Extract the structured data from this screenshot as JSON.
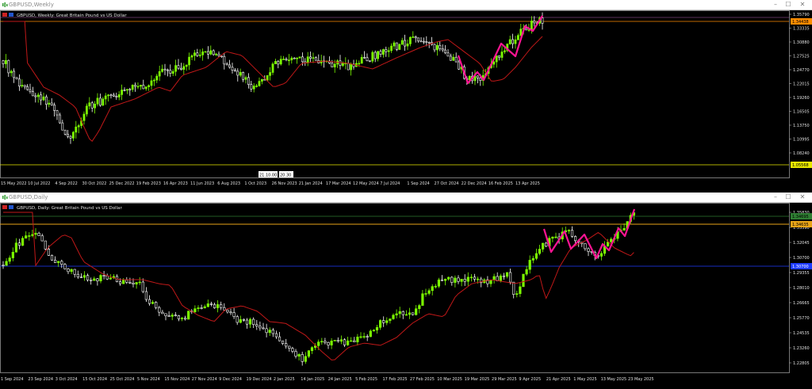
{
  "top_window": {
    "title": "GBPUSD,Weekly",
    "chart_label": "GBPUSD, Weekly:  Great Britain Pound vs US Dollar",
    "price_ticks": [
      "1.35790",
      "1.33335",
      "1.30880",
      "1.27525",
      "1.24770",
      "1.22015",
      "1.19260",
      "1.16505",
      "1.13750",
      "1.10995",
      "1.08240"
    ],
    "price_tags": [
      {
        "text": "1.34438",
        "color": "#ff8c00"
      },
      {
        "text": "1.05568",
        "color": "#e8e800"
      }
    ],
    "date_ticks": [
      "15 May 2022",
      "10 Jul 2022",
      "4 Sep 2022",
      "30 Oct 2022",
      "25 Dec 2022",
      "19 Feb 2023",
      "16 Apr 2023",
      "11 Jun 2023",
      "6 Aug 2023",
      "1 Oct 2023",
      "26 Nov 2023",
      "21 Jan 2024",
      "17 Mar 2024",
      "12 May 2024",
      "7 Jul 2024",
      "1 Sep 2024",
      "27 Oct 2024",
      "22 Dec 2024",
      "16 Feb 2025",
      "13 Apr 2025"
    ],
    "time_marker": [
      "21.10.00",
      "20.30"
    ]
  },
  "bottom_window": {
    "title": "GBPUSD,Daily",
    "chart_label": "GBPUSD, Daily:  Great Britain Pound vs US Dollar",
    "price_ticks": [
      "1.35830",
      "1.33390",
      "1.32045",
      "1.30700",
      "1.29355",
      "1.28010",
      "1.26665",
      "1.25770",
      "1.24535",
      "1.23260",
      "1.22805"
    ],
    "price_tags": [
      {
        "text": "1.34695",
        "color": "#2e7d32"
      },
      {
        "text": "1.34635",
        "color": "#e8a317"
      },
      {
        "text": "1.30700",
        "color": "#1e3cff"
      }
    ],
    "date_ticks": [
      "1 Sep 2024",
      "23 Sep 2024",
      "3 Oct 2024",
      "15 Oct 2024",
      "25 Oct 2024",
      "5 Nov 2024",
      "15 Nov 2024",
      "27 Nov 2024",
      "9 Dec 2024",
      "19 Dec 2024",
      "2 Jan 2025",
      "14 Jan 2025",
      "24 Jan 2025",
      "5 Feb 2025",
      "17 Feb 2025",
      "27 Feb 2025",
      "10 Mar 2025",
      "19 Mar 2025",
      "29 Mar 2025",
      "9 Apr 2025",
      "21 Apr 2025",
      "1 May 2025",
      "13 May 2025",
      "23 May 2025"
    ]
  },
  "colors": {
    "bull_candle": "#7CFC00",
    "bear_candle": "#ffffff",
    "moving_average": "#c01818",
    "zigzag": "#ff1493",
    "top_level_orange": "#ff8c00",
    "top_level_yellow": "#e8e800",
    "bottom_level_amber": "#e8a317",
    "bottom_level_blue": "#1e3cff",
    "bottom_level_green": "#2e7d32"
  }
}
